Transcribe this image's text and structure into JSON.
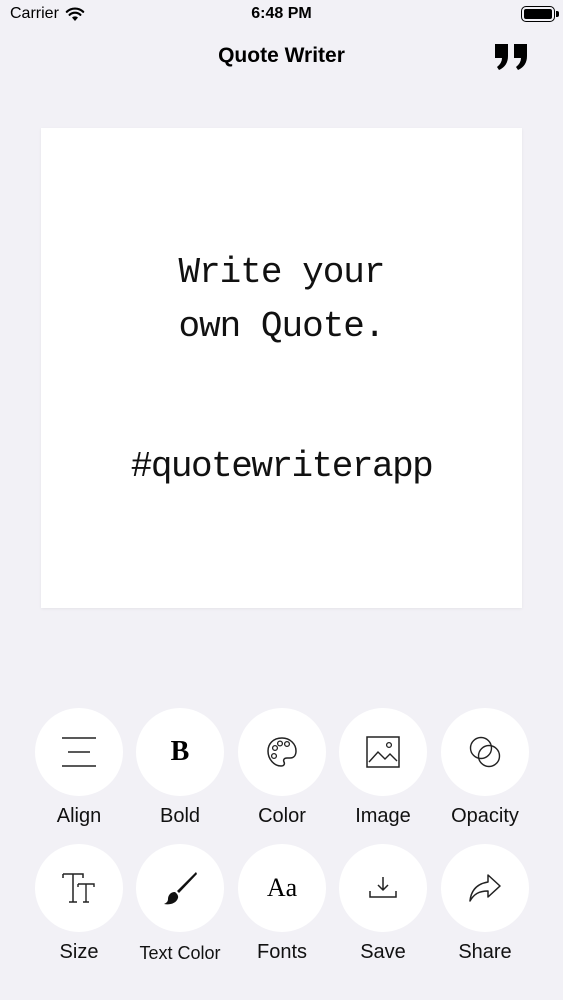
{
  "status_bar": {
    "carrier": "Carrier",
    "time": "6:48 PM"
  },
  "nav": {
    "title": "Quote Writer",
    "right_icon": "quote-icon"
  },
  "canvas": {
    "quote": "Write your\nown Quote.",
    "hashtag": "#quotewriterapp"
  },
  "toolbar": {
    "row1": [
      {
        "label": "Align",
        "icon": "align-icon"
      },
      {
        "label": "Bold",
        "icon": "bold-icon"
      },
      {
        "label": "Color",
        "icon": "palette-icon"
      },
      {
        "label": "Image",
        "icon": "image-icon"
      },
      {
        "label": "Opacity",
        "icon": "opacity-icon"
      }
    ],
    "row2": [
      {
        "label": "Size",
        "icon": "text-size-icon"
      },
      {
        "label": "Text Color",
        "icon": "brush-icon"
      },
      {
        "label": "Fonts",
        "icon": "fonts-icon"
      },
      {
        "label": "Save",
        "icon": "download-icon"
      },
      {
        "label": "Share",
        "icon": "share-icon"
      }
    ],
    "bold_glyph": "B",
    "fonts_glyph": "Aa"
  },
  "colors": {
    "background": "#f2f1f6",
    "surface": "#ffffff",
    "text": "#000000"
  }
}
